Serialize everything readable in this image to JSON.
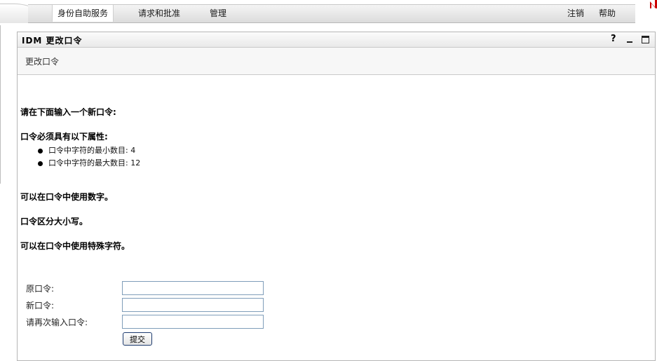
{
  "nav": {
    "tabs": [
      {
        "label": "身份自助服务"
      },
      {
        "label": "请求和批准"
      },
      {
        "label": "管理"
      }
    ],
    "logout_label": "注销",
    "help_label": "帮助"
  },
  "panel": {
    "title": "IDM 更改口令",
    "help_ctrl": "?",
    "breadcrumb": "更改口令"
  },
  "content": {
    "prompt": "请在下面输入一个新口令:",
    "rules_heading": "口令必须具有以下属性:",
    "rules": [
      {
        "text": "口令中字符的最小数目: 4"
      },
      {
        "text": "口令中字符的最大数目: 12"
      }
    ],
    "note_digits": "可以在口令中使用数字。",
    "note_case": "口令区分大小写。",
    "note_special": "可以在口令中使用特殊字符。"
  },
  "form": {
    "old_label": "原口令:",
    "old_value": "",
    "new_label": "新口令:",
    "new_value": "",
    "confirm_label": "请再次输入口令:",
    "confirm_value": "",
    "submit_label": "提交"
  },
  "colors": {
    "brand_red": "#cc0000",
    "input_border": "#7f9db9",
    "button_border": "#1c3a6e"
  }
}
